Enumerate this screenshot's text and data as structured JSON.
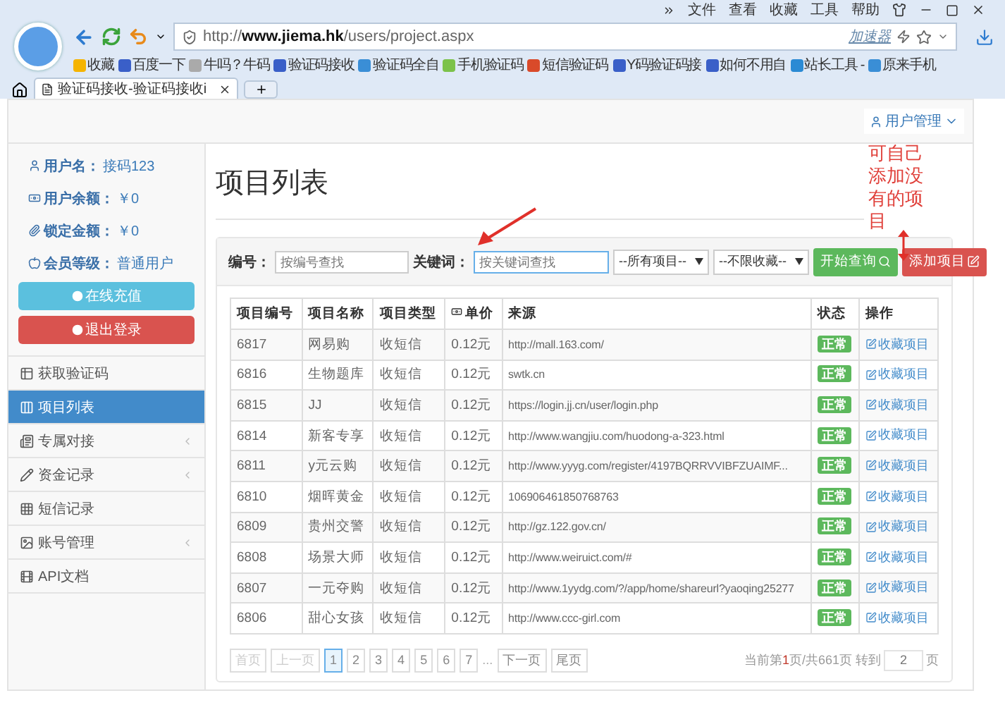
{
  "browser": {
    "menu": [
      "文件",
      "查看",
      "收藏",
      "工具",
      "帮助"
    ],
    "url_prefix": "http://",
    "url_host": "www.jiema.hk",
    "url_path": "/users/project.aspx",
    "accelerator": "加速器",
    "bookmarks": [
      "收藏",
      "百度一下",
      "牛吗？牛码",
      "验证码接收",
      "验证码全自",
      "手机验证码",
      "短信验证码",
      "Y码验证码接",
      "如何不用自",
      "站长工具 -",
      "原来手机"
    ],
    "tab": {
      "title": "验证码接收-验证码接收i",
      "selected": true
    }
  },
  "navbar": {
    "user_menu": "用户管理"
  },
  "sidebar": {
    "info": [
      {
        "label": "用户名：",
        "value": "接码123"
      },
      {
        "label": "用户余额：",
        "value": "￥0"
      },
      {
        "label": "锁定金额：",
        "value": "￥0"
      },
      {
        "label": "会员等级：",
        "value": "普通用户"
      }
    ],
    "buttons": [
      {
        "label": "在线充值",
        "kind": "info"
      },
      {
        "label": "退出登录",
        "kind": "danger"
      }
    ],
    "items": [
      {
        "label": "获取验证码",
        "selected": false,
        "expandable": false
      },
      {
        "label": "项目列表",
        "selected": true,
        "expandable": false
      },
      {
        "label": "专属对接",
        "selected": false,
        "expandable": true
      },
      {
        "label": "资金记录",
        "selected": false,
        "expandable": true
      },
      {
        "label": "短信记录",
        "selected": false,
        "expandable": false
      },
      {
        "label": "账号管理",
        "selected": false,
        "expandable": true
      },
      {
        "label": "API文档",
        "selected": false,
        "expandable": false
      }
    ]
  },
  "page_title": "项目列表",
  "filter": {
    "id_label": "编号：",
    "id_placeholder": "按编号查找",
    "keyword_label": "关键词：",
    "keyword_placeholder": "按关键词查找",
    "selects": [
      "--所有项目--",
      "--不限收藏--"
    ],
    "search_button": "开始查询",
    "add_button": "添加项目"
  },
  "table": {
    "columns": [
      "项目编号",
      "项目名称",
      "项目类型",
      "单价",
      "来源",
      "状态",
      "操作"
    ],
    "rows": [
      {
        "id": "6817",
        "name": "网易购",
        "type": "收短信",
        "price": "0.12元",
        "source": "http://mall.163.com/",
        "status": "正常",
        "action": "收藏项目"
      },
      {
        "id": "6816",
        "name": "生物题库",
        "type": "收短信",
        "price": "0.12元",
        "source": "swtk.cn",
        "status": "正常",
        "action": "收藏项目"
      },
      {
        "id": "6815",
        "name": "JJ",
        "type": "收短信",
        "price": "0.12元",
        "source": "https://login.jj.cn/user/login.php",
        "status": "正常",
        "action": "收藏项目"
      },
      {
        "id": "6814",
        "name": "新客专享",
        "type": "收短信",
        "price": "0.12元",
        "source": "http://www.wangjiu.com/huodong-a-323.html",
        "status": "正常",
        "action": "收藏项目"
      },
      {
        "id": "6811",
        "name": "y元云购",
        "type": "收短信",
        "price": "0.12元",
        "source": "http://www.yyyg.com/register/4197BQRRVVIBFZUAIMF...",
        "status": "正常",
        "action": "收藏项目"
      },
      {
        "id": "6810",
        "name": "烟晖黄金",
        "type": "收短信",
        "price": "0.12元",
        "source": "106906461850768763",
        "status": "正常",
        "action": "收藏项目"
      },
      {
        "id": "6809",
        "name": "贵州交警",
        "type": "收短信",
        "price": "0.12元",
        "source": "http://gz.122.gov.cn/",
        "status": "正常",
        "action": "收藏项目"
      },
      {
        "id": "6808",
        "name": "场景大师",
        "type": "收短信",
        "price": "0.12元",
        "source": "http://www.weiruict.com/#",
        "status": "正常",
        "action": "收藏项目"
      },
      {
        "id": "6807",
        "name": "一元夺购",
        "type": "收短信",
        "price": "0.12元",
        "source": "http://www.1yydg.com/?/app/home/shareurl?yaoqing25277",
        "status": "正常",
        "action": "收藏项目"
      },
      {
        "id": "6806",
        "name": "甜心女孩",
        "type": "收短信",
        "price": "0.12元",
        "source": "http://www.ccc-girl.com",
        "status": "正常",
        "action": "收藏项目"
      }
    ]
  },
  "pagination": {
    "items": [
      {
        "label": "首页",
        "kind": "link",
        "selected": false,
        "disabled": true
      },
      {
        "label": "上一页",
        "kind": "link",
        "selected": false,
        "disabled": true
      },
      {
        "label": "1",
        "kind": "link",
        "selected": true,
        "disabled": false
      },
      {
        "label": "2",
        "kind": "link",
        "selected": false,
        "disabled": false
      },
      {
        "label": "3",
        "kind": "link",
        "selected": false,
        "disabled": false
      },
      {
        "label": "4",
        "kind": "link",
        "selected": false,
        "disabled": false
      },
      {
        "label": "5",
        "kind": "link",
        "selected": false,
        "disabled": false
      },
      {
        "label": "6",
        "kind": "link",
        "selected": false,
        "disabled": false
      },
      {
        "label": "7",
        "kind": "link",
        "selected": false,
        "disabled": false
      },
      {
        "label": "...",
        "kind": "ellipsis",
        "selected": false,
        "disabled": false
      },
      {
        "label": "下一页",
        "kind": "link",
        "selected": false,
        "disabled": false
      },
      {
        "label": "尾页",
        "kind": "link",
        "selected": false,
        "disabled": false
      }
    ],
    "summary_prefix": "当前第",
    "current": "1",
    "summary_suffix": "页/共661页 转到",
    "goto_value": "2",
    "goto_unit": "页"
  },
  "annotation": {
    "note": "可自己添加没有的项目"
  }
}
